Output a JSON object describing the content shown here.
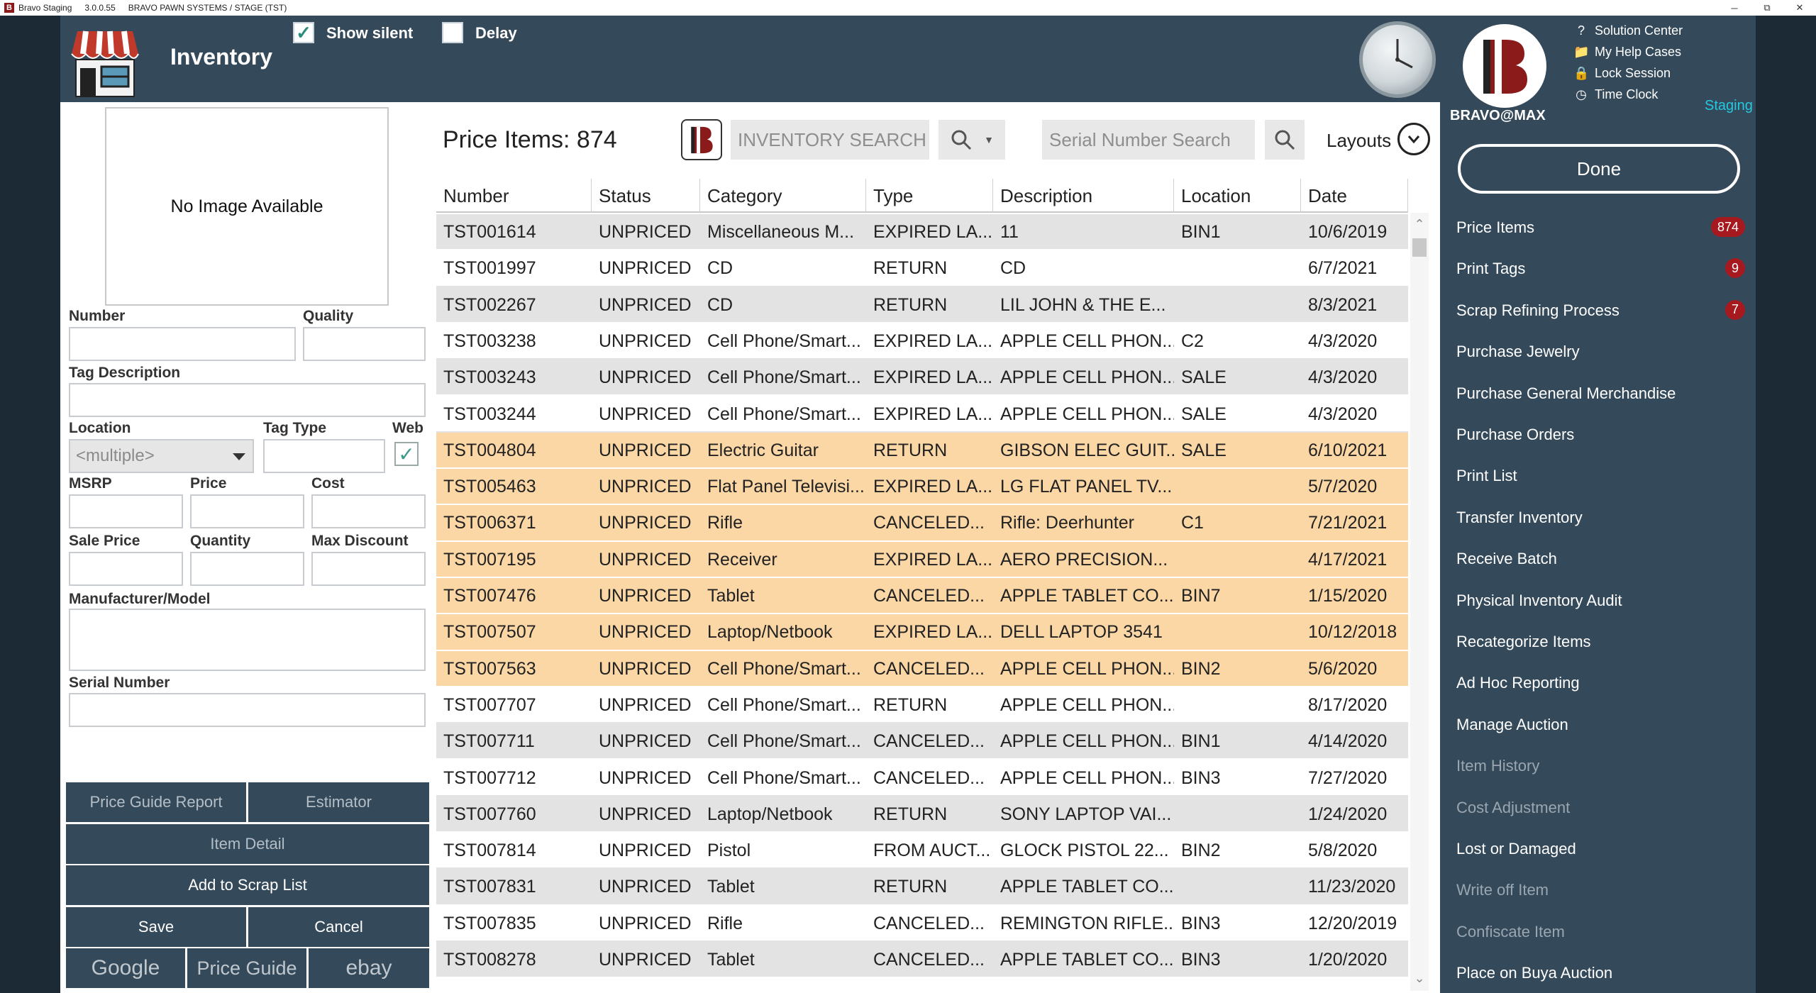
{
  "window": {
    "app_name": "Bravo Staging",
    "version": "3.0.0.55",
    "environment": "BRAVO PAWN SYSTEMS / STAGE (TST)",
    "controls": [
      "─",
      "✕"
    ]
  },
  "header": {
    "title": "Inventory",
    "show_silent_label": "Show silent",
    "delay_label": "Delay"
  },
  "brand": {
    "name": "BRAVO@MAX",
    "staging_label": "Staging",
    "links": [
      "Solution Center",
      "My Help Cases",
      "Lock Session",
      "Time Clock"
    ],
    "done_label": "Done"
  },
  "nav": [
    {
      "label": "Price Items",
      "badge": "874",
      "enabled": true
    },
    {
      "label": "Print Tags",
      "badge": "9",
      "enabled": true
    },
    {
      "label": "Scrap Refining Process",
      "badge": "7",
      "enabled": true
    },
    {
      "label": "Purchase Jewelry",
      "enabled": true
    },
    {
      "label": "Purchase General Merchandise",
      "enabled": true
    },
    {
      "label": "Purchase Orders",
      "enabled": true
    },
    {
      "label": "Print List",
      "enabled": true
    },
    {
      "label": "Transfer Inventory",
      "enabled": true
    },
    {
      "label": "Receive Batch",
      "enabled": true
    },
    {
      "label": "Physical Inventory Audit",
      "enabled": true
    },
    {
      "label": "Recategorize Items",
      "enabled": true
    },
    {
      "label": "Ad Hoc Reporting",
      "enabled": true
    },
    {
      "label": "Manage Auction",
      "enabled": true
    },
    {
      "label": "Item History",
      "enabled": false
    },
    {
      "label": "Cost Adjustment",
      "enabled": false
    },
    {
      "label": "Lost or Damaged",
      "enabled": true
    },
    {
      "label": "Write off Item",
      "enabled": false
    },
    {
      "label": "Confiscate Item",
      "enabled": false
    },
    {
      "label": "Place on Buya Auction",
      "enabled": true
    }
  ],
  "form": {
    "no_image": "No Image Available",
    "labels": {
      "number": "Number",
      "quality": "Quality",
      "tag_description": "Tag Description",
      "location": "Location",
      "tag_type": "Tag Type",
      "web": "Web",
      "msrp": "MSRP",
      "price": "Price",
      "cost": "Cost",
      "sale_price": "Sale Price",
      "quantity": "Quantity",
      "max_discount": "Max Discount",
      "manufacturer_model": "Manufacturer/Model",
      "serial_number": "Serial Number"
    },
    "location_value": "<multiple>",
    "buttons": {
      "price_guide_report": "Price Guide Report",
      "estimator": "Estimator",
      "item_detail": "Item Detail",
      "add_to_scrap": "Add to Scrap List",
      "save": "Save",
      "cancel": "Cancel",
      "google": "Google",
      "price_guide": "Price Guide",
      "ebay": "ebay"
    }
  },
  "toolbar": {
    "price_items_label": "Price Items: 874",
    "inventory_search_placeholder": "INVENTORY SEARCH",
    "serial_search_placeholder": "Serial Number Search",
    "layouts_label": "Layouts"
  },
  "grid": {
    "columns": [
      "Number",
      "Status",
      "Category",
      "Type",
      "Description",
      "Location",
      "Date"
    ],
    "rows": [
      {
        "number": "TST001614",
        "status": "UNPRICED",
        "category": "Miscellaneous M...",
        "type": "EXPIRED LA...",
        "description": "11",
        "location": "BIN1",
        "date": "10/6/2019",
        "style": "gray"
      },
      {
        "number": "TST001997",
        "status": "UNPRICED",
        "category": "CD",
        "type": "RETURN",
        "description": "CD",
        "location": "",
        "date": "6/7/2021",
        "style": "white"
      },
      {
        "number": "TST002267",
        "status": "UNPRICED",
        "category": "CD",
        "type": "RETURN",
        "description": "LIL JOHN & THE E...",
        "location": "",
        "date": "8/3/2021",
        "style": "gray"
      },
      {
        "number": "TST003238",
        "status": "UNPRICED",
        "category": "Cell Phone/Smart...",
        "type": "EXPIRED LA...",
        "description": "APPLE CELL PHON...",
        "location": "C2",
        "date": "4/3/2020",
        "style": "white"
      },
      {
        "number": "TST003243",
        "status": "UNPRICED",
        "category": "Cell Phone/Smart...",
        "type": "EXPIRED LA...",
        "description": "APPLE CELL PHON...",
        "location": "SALE",
        "date": "4/3/2020",
        "style": "gray"
      },
      {
        "number": "TST003244",
        "status": "UNPRICED",
        "category": "Cell Phone/Smart...",
        "type": "EXPIRED LA...",
        "description": "APPLE CELL PHON...",
        "location": "SALE",
        "date": "4/3/2020",
        "style": "white"
      },
      {
        "number": "TST004804",
        "status": "UNPRICED",
        "category": "Electric Guitar",
        "type": "RETURN",
        "description": "GIBSON ELEC GUIT...",
        "location": "SALE",
        "date": "6/10/2021",
        "style": "orange"
      },
      {
        "number": "TST005463",
        "status": "UNPRICED",
        "category": "Flat Panel Televisi...",
        "type": "EXPIRED LA...",
        "description": "LG FLAT PANEL TV...",
        "location": "",
        "date": "5/7/2020",
        "style": "orange"
      },
      {
        "number": "TST006371",
        "status": "UNPRICED",
        "category": "Rifle",
        "type": "CANCELED...",
        "description": "Rifle: Deerhunter",
        "location": "C1",
        "date": "7/21/2021",
        "style": "orange"
      },
      {
        "number": "TST007195",
        "status": "UNPRICED",
        "category": "Receiver",
        "type": "EXPIRED LA...",
        "description": "AERO PRECISION...",
        "location": "",
        "date": "4/17/2021",
        "style": "orange"
      },
      {
        "number": "TST007476",
        "status": "UNPRICED",
        "category": "Tablet",
        "type": "CANCELED...",
        "description": "APPLE TABLET CO...",
        "location": "BIN7",
        "date": "1/15/2020",
        "style": "orange"
      },
      {
        "number": "TST007507",
        "status": "UNPRICED",
        "category": "Laptop/Netbook",
        "type": "EXPIRED LA...",
        "description": "DELL LAPTOP 3541",
        "location": "",
        "date": "10/12/2018",
        "style": "orange"
      },
      {
        "number": "TST007563",
        "status": "UNPRICED",
        "category": "Cell Phone/Smart...",
        "type": "CANCELED...",
        "description": "APPLE CELL PHON...",
        "location": "BIN2",
        "date": "5/6/2020",
        "style": "orange"
      },
      {
        "number": "TST007707",
        "status": "UNPRICED",
        "category": "Cell Phone/Smart...",
        "type": "RETURN",
        "description": "APPLE CELL PHON...",
        "location": "",
        "date": "8/17/2020",
        "style": "white"
      },
      {
        "number": "TST007711",
        "status": "UNPRICED",
        "category": "Cell Phone/Smart...",
        "type": "CANCELED...",
        "description": "APPLE CELL PHON...",
        "location": "BIN1",
        "date": "4/14/2020",
        "style": "gray"
      },
      {
        "number": "TST007712",
        "status": "UNPRICED",
        "category": "Cell Phone/Smart...",
        "type": "CANCELED...",
        "description": "APPLE CELL PHON...",
        "location": "BIN3",
        "date": "7/27/2020",
        "style": "white"
      },
      {
        "number": "TST007760",
        "status": "UNPRICED",
        "category": "Laptop/Netbook",
        "type": "RETURN",
        "description": "SONY LAPTOP VAI...",
        "location": "",
        "date": "1/24/2020",
        "style": "gray"
      },
      {
        "number": "TST007814",
        "status": "UNPRICED",
        "category": "Pistol",
        "type": "FROM AUCT...",
        "description": "GLOCK PISTOL 22...",
        "location": "BIN2",
        "date": "5/8/2020",
        "style": "white"
      },
      {
        "number": "TST007831",
        "status": "UNPRICED",
        "category": "Tablet",
        "type": "RETURN",
        "description": "APPLE TABLET CO...",
        "location": "",
        "date": "11/23/2020",
        "style": "gray"
      },
      {
        "number": "TST007835",
        "status": "UNPRICED",
        "category": "Rifle",
        "type": "CANCELED...",
        "description": "REMINGTON RIFLE...",
        "location": "BIN3",
        "date": "12/20/2019",
        "style": "white"
      },
      {
        "number": "TST008278",
        "status": "UNPRICED",
        "category": "Tablet",
        "type": "CANCELED...",
        "description": "APPLE TABLET CO...",
        "location": "BIN3",
        "date": "1/20/2020",
        "style": "gray"
      }
    ]
  },
  "colors": {
    "header_bg": "#34495a",
    "row_highlight": "#fcd7a6",
    "badge": "#a6191f",
    "staging_text": "#23c9e0"
  }
}
